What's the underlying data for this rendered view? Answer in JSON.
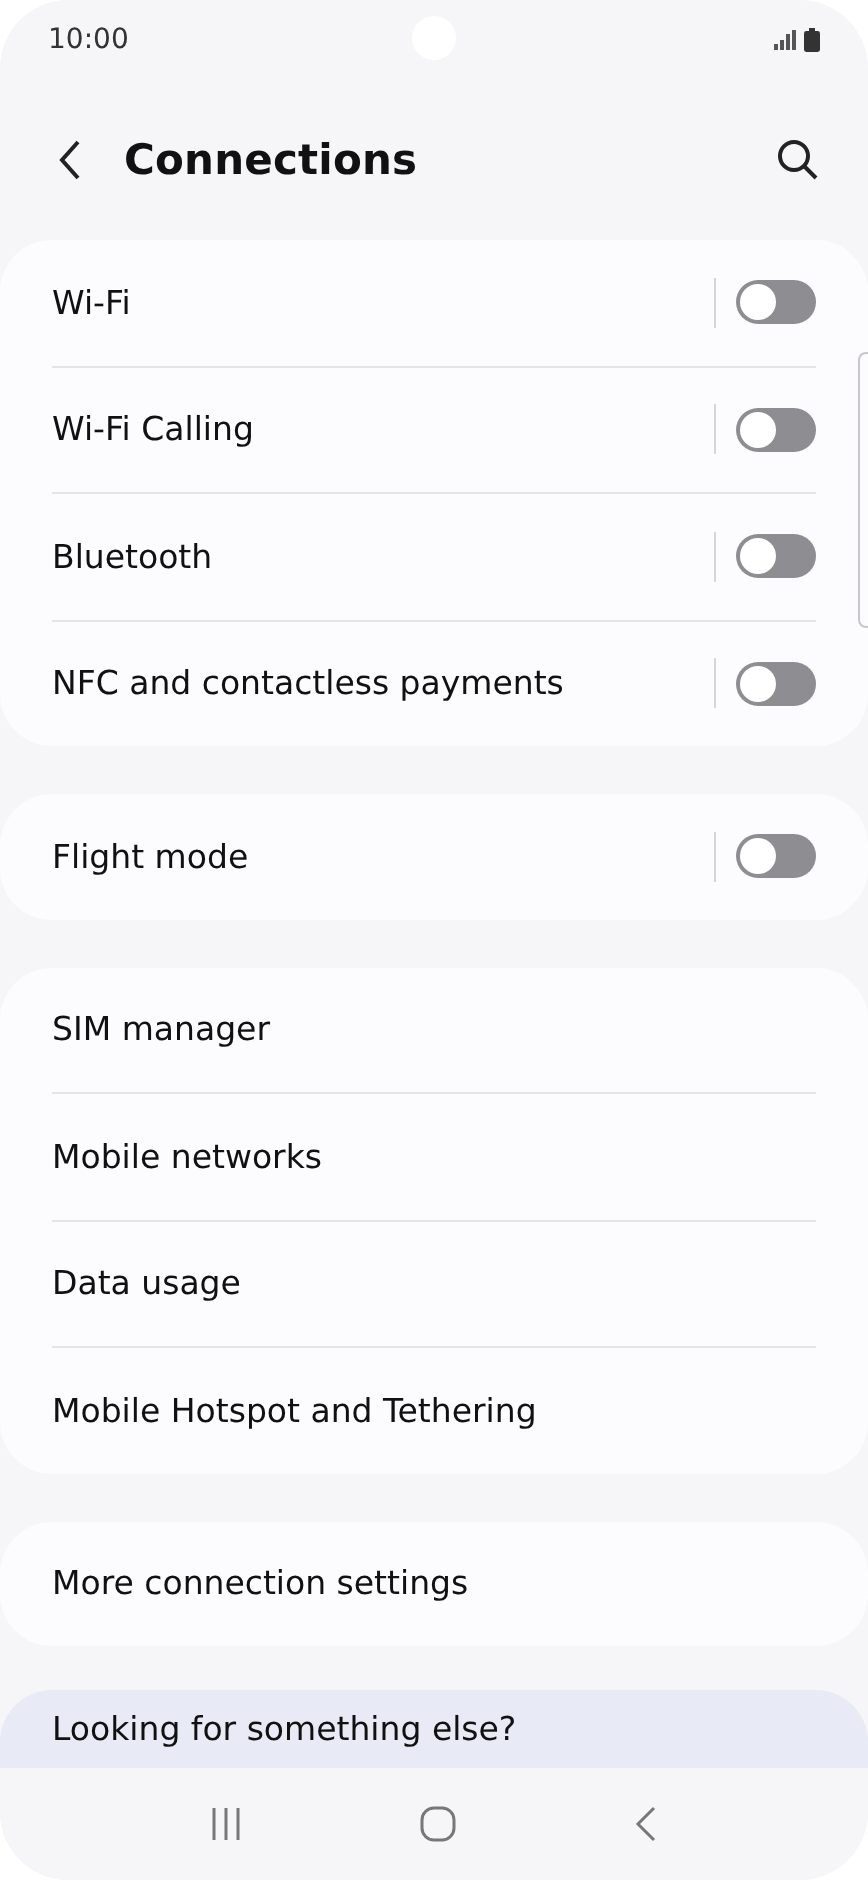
{
  "status_bar": {
    "time": "10:00"
  },
  "header": {
    "title": "Connections"
  },
  "groups": [
    {
      "items": [
        {
          "label": "Wi-Fi",
          "kind": "toggle",
          "on": false
        },
        {
          "label": "Wi-Fi Calling",
          "kind": "toggle",
          "on": false
        },
        {
          "label": "Bluetooth",
          "kind": "toggle",
          "on": false
        },
        {
          "label": "NFC and contactless payments",
          "kind": "toggle",
          "on": false
        }
      ]
    },
    {
      "items": [
        {
          "label": "Flight mode",
          "kind": "toggle",
          "on": false
        }
      ]
    },
    {
      "items": [
        {
          "label": "SIM manager",
          "kind": "link"
        },
        {
          "label": "Mobile networks",
          "kind": "link"
        },
        {
          "label": "Data usage",
          "kind": "link"
        },
        {
          "label": "Mobile Hotspot and Tethering",
          "kind": "link"
        }
      ]
    },
    {
      "items": [
        {
          "label": "More connection settings",
          "kind": "link"
        }
      ]
    }
  ],
  "suggestion": {
    "title": "Looking for something else?"
  }
}
